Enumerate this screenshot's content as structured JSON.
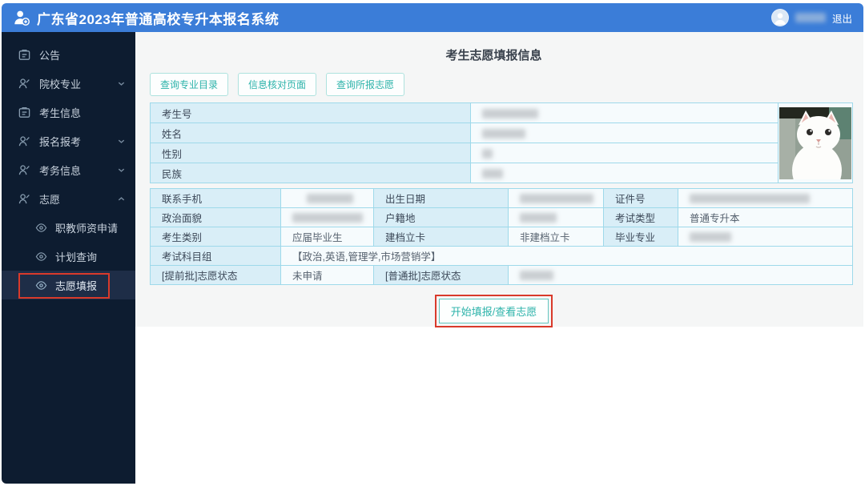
{
  "header": {
    "app_title": "广东省2023年普通高校专升本报名系统",
    "logout_label": "退出",
    "username_redacted": true
  },
  "sidebar": {
    "items": [
      {
        "label": "公告",
        "icon": "announcement-icon",
        "expandable": false
      },
      {
        "label": "院校专业",
        "icon": "person-icon",
        "expandable": true,
        "state": "collapsed"
      },
      {
        "label": "考生信息",
        "icon": "announcement-icon",
        "expandable": false
      },
      {
        "label": "报名报考",
        "icon": "person-icon",
        "expandable": true,
        "state": "collapsed"
      },
      {
        "label": "考务信息",
        "icon": "person-icon",
        "expandable": true,
        "state": "collapsed"
      },
      {
        "label": "志愿",
        "icon": "person-icon",
        "expandable": true,
        "state": "expanded"
      }
    ],
    "sub_items": [
      {
        "label": "职教师资申请",
        "selected": false
      },
      {
        "label": "计划查询",
        "selected": false
      },
      {
        "label": "志愿填报",
        "selected": true,
        "annotated_with_red_box": true
      }
    ]
  },
  "main": {
    "page_title": "考生志愿填报信息",
    "toolbar_buttons": [
      {
        "label": "查询专业目录"
      },
      {
        "label": "信息核对页面"
      },
      {
        "label": "查询所报志愿"
      }
    ],
    "profile_table": {
      "rows": [
        {
          "label": "考生号",
          "value_redacted": true
        },
        {
          "label": "姓名",
          "value_redacted": true
        },
        {
          "label": "性别",
          "value_redacted": true
        },
        {
          "label": "民族",
          "value_redacted": true
        }
      ],
      "photo": "white-cat-photo"
    },
    "detail_table": {
      "rows": [
        {
          "l1": "联系手机",
          "v1_redacted": true,
          "l2": "出生日期",
          "v2_redacted": true,
          "l3": "证件号",
          "v3_redacted": true
        },
        {
          "l1": "政治面貌",
          "v1_redacted": true,
          "l2": "户籍地",
          "v2_redacted": true,
          "l3": "考试类型",
          "v3": "普通专升本"
        },
        {
          "l1": "考生类别",
          "v1": "应届毕业生",
          "l2": "建档立卡",
          "v2": "非建档立卡",
          "l3": "毕业专业",
          "v3_redacted": true
        },
        {
          "l1": "考试科目组",
          "v1": "【政治,英语,管理学,市场营销学】"
        },
        {
          "l1": "[提前批]志愿状态",
          "v1": "未申请",
          "l2": "[普通批]志愿状态",
          "v2_redacted": true
        }
      ]
    },
    "action_button_label": "开始填报/查看志愿"
  },
  "colors": {
    "header_bg": "#3b7dd8",
    "sidebar_bg": "#0d1c30",
    "accent_teal": "#2db3aa",
    "table_border": "#9ed9ea",
    "label_cell_bg": "#d9eef7",
    "annotation_red": "#d93a2b"
  }
}
